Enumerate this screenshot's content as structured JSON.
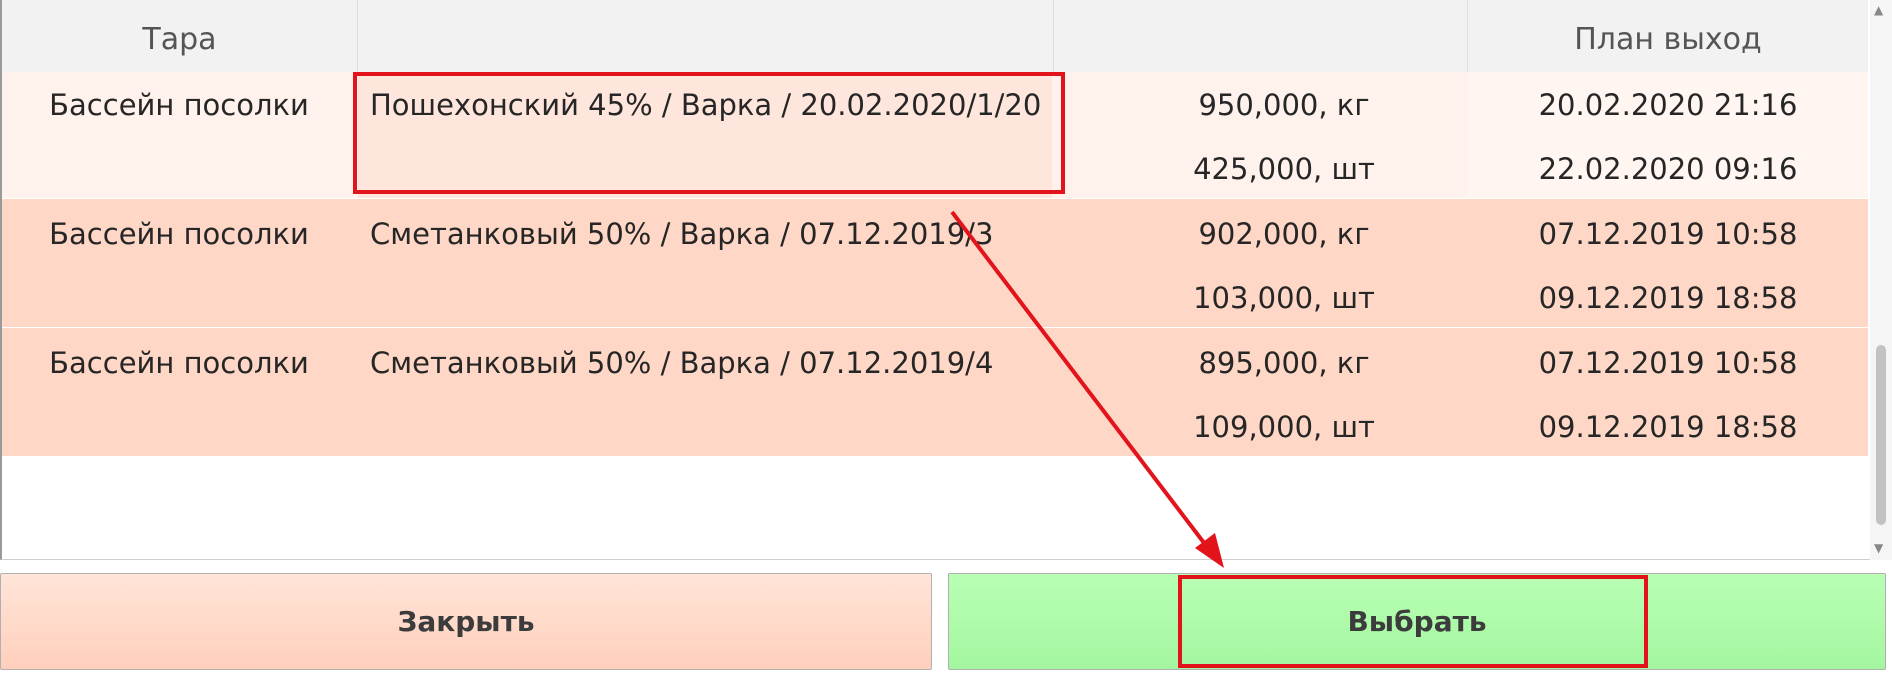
{
  "header": {
    "col_tara": "Тара",
    "col_name": "",
    "col_qty": "",
    "col_plan": "План выход"
  },
  "rows": [
    {
      "tara": "Бассейн посолки",
      "name": "Пошехонский 45% / Варка / 20.02.2020/1/20",
      "qty1": "950,000, кг",
      "date1": "20.02.2020 21:16",
      "qty2": "425,000, шт",
      "date2": "22.02.2020 09:16"
    },
    {
      "tara": "Бассейн посолки",
      "name": "Сметанковый 50% / Варка / 07.12.2019/3",
      "qty1": "902,000, кг",
      "date1": "07.12.2019 10:58",
      "qty2": "103,000, шт",
      "date2": "09.12.2019 18:58"
    },
    {
      "tara": "Бассейн посолки",
      "name": "Сметанковый 50% / Варка / 07.12.2019/4",
      "qty1": "895,000, кг",
      "date1": "07.12.2019 10:58",
      "qty2": "109,000, шт",
      "date2": "09.12.2019 18:58"
    }
  ],
  "buttons": {
    "close_label": "Закрыть",
    "select_label": "Выбрать"
  },
  "colors": {
    "highlight": "#e3131b",
    "row_selected": "#fff2ec",
    "row_normal": "#ffd7c6",
    "close_button": "#ffd9c9",
    "select_button": "#aefaa9"
  },
  "icons": {
    "scroll_up": "chevron-up-icon",
    "scroll_down": "chevron-down-icon",
    "annotation": "arrow-annotation-icon"
  }
}
